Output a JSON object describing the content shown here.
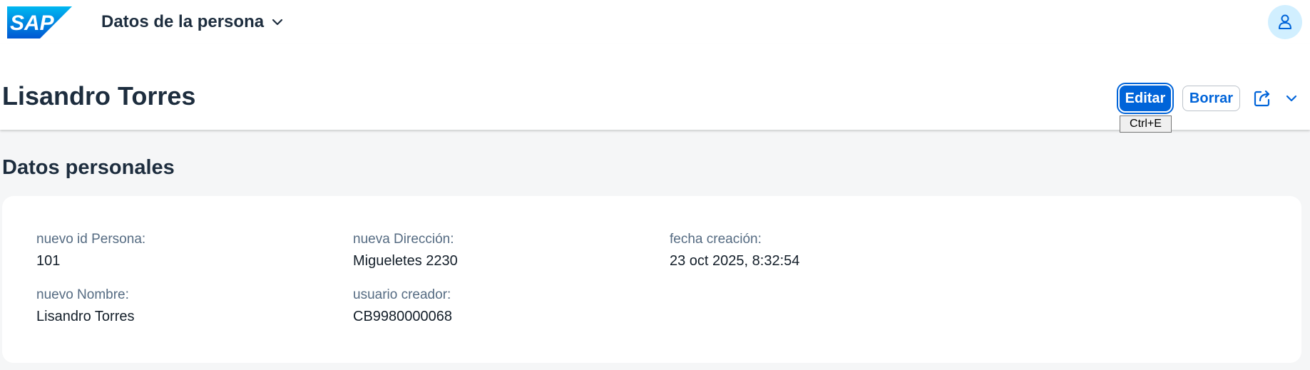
{
  "shell": {
    "logo_text": "SAP",
    "app_title": "Datos de la persona"
  },
  "header": {
    "title": "Lisandro Torres",
    "edit_label": "Editar",
    "delete_label": "Borrar",
    "edit_shortcut_tooltip": "Ctrl+E"
  },
  "section": {
    "title": "Datos personales",
    "fields": [
      {
        "label": "nuevo id Persona:",
        "value": "101"
      },
      {
        "label": "nuevo Nombre:",
        "value": "Lisandro Torres"
      },
      {
        "label": "nueva Dirección:",
        "value": "Migueletes 2230"
      },
      {
        "label": "usuario creador:",
        "value": "CB9980000068"
      },
      {
        "label": "fecha creación:",
        "value": "23 oct 2025, 8:32:54"
      }
    ]
  },
  "icons": [
    "sap-logo",
    "chevron-down-icon",
    "person-icon",
    "share-icon"
  ],
  "colors": {
    "brand_blue": "#0064d9",
    "shell_background": "#ffffff",
    "page_background": "#f5f6f7",
    "avatar_background": "#d1efff",
    "label_gray": "#556b82",
    "text_dark": "#1d2d3e"
  }
}
